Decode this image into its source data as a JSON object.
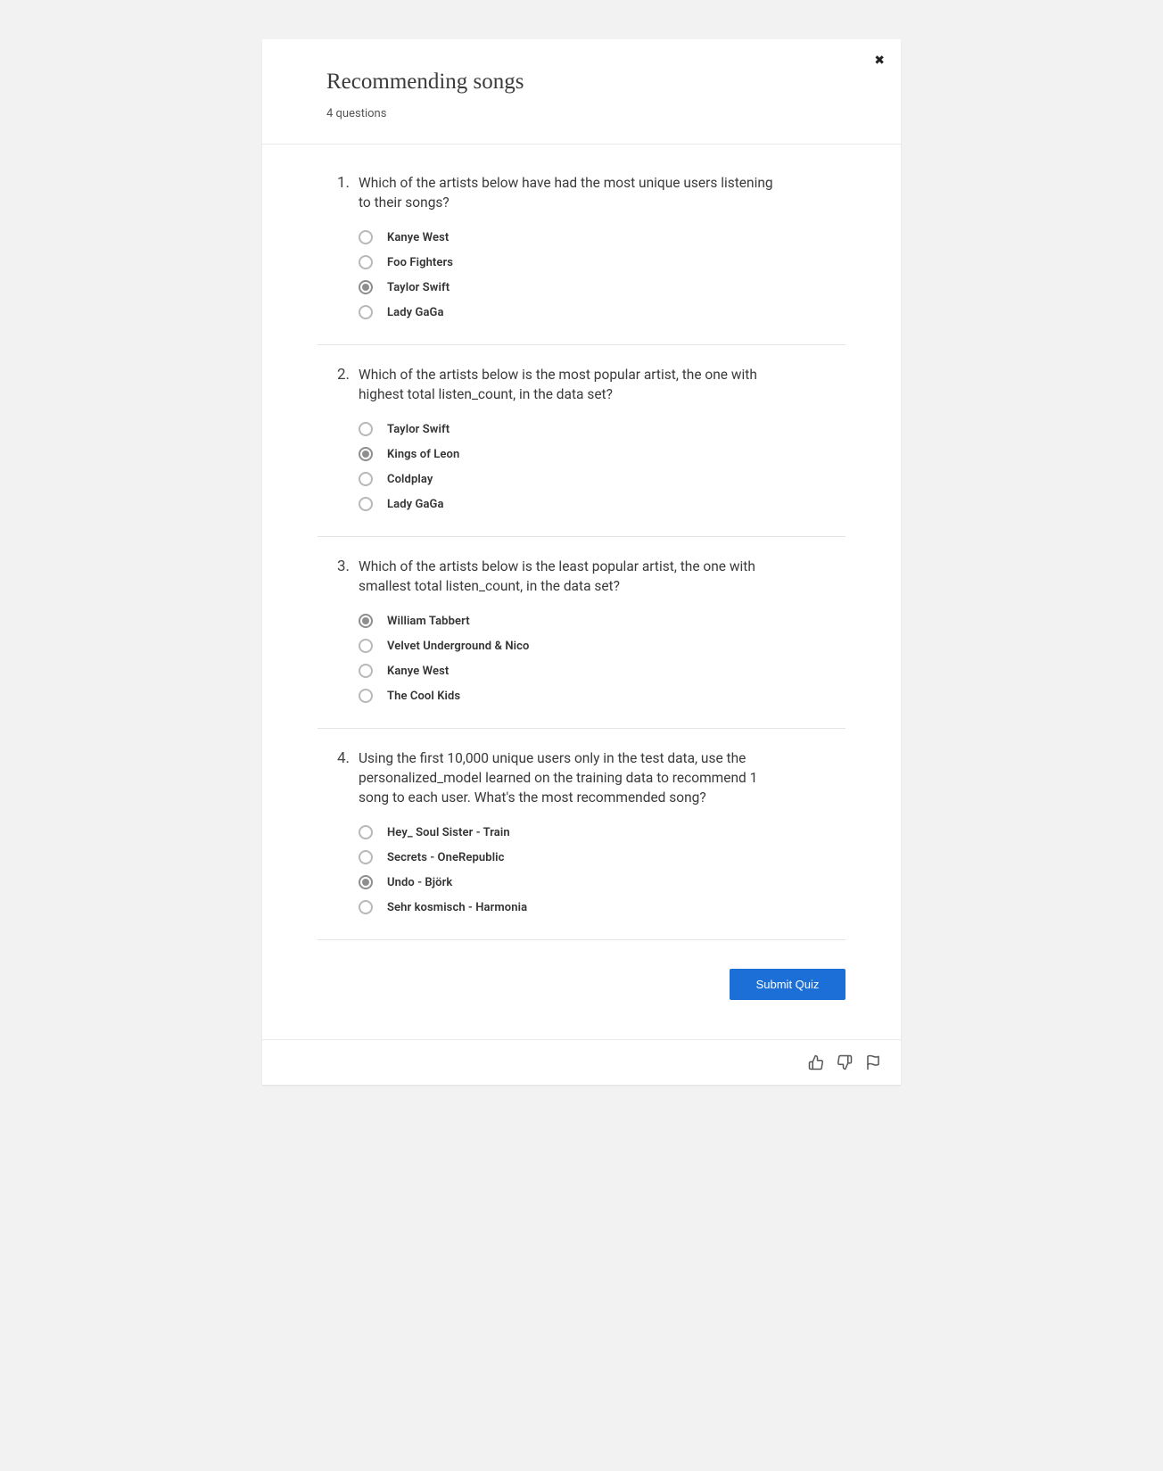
{
  "header": {
    "title": "Recommending songs",
    "subtitle": "4 questions"
  },
  "questions": [
    {
      "number": "1.",
      "text": "Which of the artists below have had the most unique users listening to their songs?",
      "options": [
        {
          "label": "Kanye West",
          "selected": false
        },
        {
          "label": "Foo Fighters",
          "selected": false
        },
        {
          "label": "Taylor Swift",
          "selected": true
        },
        {
          "label": "Lady GaGa",
          "selected": false
        }
      ]
    },
    {
      "number": "2.",
      "text": "Which of the artists below is the most popular artist, the one with highest total listen_count, in the data set?",
      "options": [
        {
          "label": "Taylor Swift",
          "selected": false
        },
        {
          "label": "Kings of Leon",
          "selected": true
        },
        {
          "label": "Coldplay",
          "selected": false
        },
        {
          "label": "Lady GaGa",
          "selected": false
        }
      ]
    },
    {
      "number": "3.",
      "text": "Which of the artists below is the least popular artist, the one with smallest total listen_count, in the data set?",
      "options": [
        {
          "label": "William Tabbert",
          "selected": true
        },
        {
          "label": "Velvet Underground & Nico",
          "selected": false
        },
        {
          "label": "Kanye West",
          "selected": false
        },
        {
          "label": "The Cool Kids",
          "selected": false
        }
      ]
    },
    {
      "number": "4.",
      "text": "Using the first 10,000 unique users only in the test data, use the personalized_model learned on the training data to recommend 1 song to each user. What's the most recommended song?",
      "options": [
        {
          "label": "Hey_ Soul Sister - Train",
          "selected": false
        },
        {
          "label": "Secrets - OneRepublic",
          "selected": false
        },
        {
          "label": "Undo - Björk",
          "selected": true
        },
        {
          "label": "Sehr kosmisch - Harmonia",
          "selected": false
        }
      ]
    }
  ],
  "submit_label": "Submit Quiz"
}
